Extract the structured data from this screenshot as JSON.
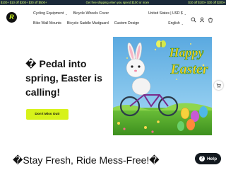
{
  "ticker": [
    "$100+ $10 off $300+ $30 off $500+",
    "Get free shipping when you spend $100 or more",
    "$10 off $100+ $30 off $300+"
  ],
  "header": {
    "brand_letter": "R",
    "nav_row1": [
      "Cycling Equipment",
      "Bicycle Wheels Cover"
    ],
    "nav_row2": [
      "Bike Wall Mounts",
      "Bicycle Saddle Mudguard",
      "Custom Design"
    ],
    "currency": "United States | USD $",
    "language": "English"
  },
  "hero": {
    "title": "� Pedal into spring, Easter is calling!",
    "cta_label": "Don't Miss Out!",
    "art_text_line1": "Happy",
    "art_text_line2": "Easter"
  },
  "section": {
    "title": "�Stay Fresh, Ride Mess-Free!�"
  },
  "help": {
    "label": "Help",
    "icon_glyph": "?"
  },
  "colors": {
    "ticker_bg": "#1b2a3a",
    "accent": "#d7f21a",
    "help_bg": "#13191f"
  }
}
